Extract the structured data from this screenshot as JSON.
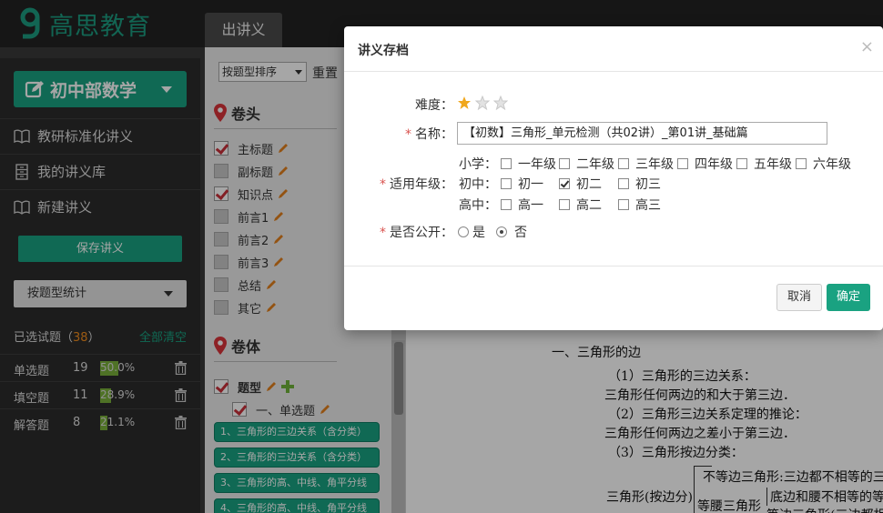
{
  "app": {
    "logo_text": "高思教育",
    "main_tab": "出讲义"
  },
  "sidebar": {
    "subject": "初中部数学",
    "nav": [
      {
        "label": "教研标准化讲义",
        "icon": "book-icon"
      },
      {
        "label": "我的讲义库",
        "icon": "cabinet-icon"
      },
      {
        "label": "新建讲义",
        "icon": "book-icon"
      }
    ],
    "save_label": "保存讲义",
    "stat_select": "按题型统计",
    "selected_label": "已选试题（",
    "selected_count": "38",
    "selected_close": "）",
    "clear_all": "全部清空",
    "stats": [
      {
        "name": "单选题",
        "count": "19",
        "percent": "50.0%",
        "fraction": 0.5
      },
      {
        "name": "填空题",
        "count": "11",
        "percent": "28.9%",
        "fraction": 0.289
      },
      {
        "name": "解答题",
        "count": "8",
        "percent": "21.1%",
        "fraction": 0.211
      }
    ]
  },
  "options": {
    "sort_select": "按题型排序",
    "reset_label": "重置",
    "head_title": "卷头",
    "head_items": [
      {
        "label": "主标题",
        "checked": true
      },
      {
        "label": "副标题",
        "checked": false
      },
      {
        "label": "知识点",
        "checked": true
      },
      {
        "label": "前言1",
        "checked": false
      },
      {
        "label": "前言2",
        "checked": false
      },
      {
        "label": "前言3",
        "checked": false
      },
      {
        "label": "总结",
        "checked": false
      },
      {
        "label": "其它",
        "checked": false
      }
    ],
    "body_title": "卷体",
    "question_type_label": "题型",
    "section_one": "一、单选题",
    "topics": [
      "1、三角形的三边关系（含分类）",
      "2、三角形的三边关系（含分类）",
      "3、三角形的高、中线、角平分线",
      "4、三角形的高、中线、角平分线"
    ]
  },
  "document": {
    "lines": [
      "一、三角形的边",
      "（1）三角形的三边关系：",
      "三角形任何两边的和大于第三边．",
      "（2）三角形三边关系定理的推论：",
      "三角形任何两边之差小于第三边．",
      "（3）三角形按边分类：",
      "不等边三角形:三边都不相等的三角",
      "三角形(按边分)",
      "等腰三角形",
      "底边和腰不相等的等腰",
      "等边三角形(三边都相"
    ]
  },
  "modal": {
    "title": "讲义存档",
    "close": "×",
    "difficulty_label": "难度：",
    "difficulty_stars": 1,
    "difficulty_max": 3,
    "name_label": "名称：",
    "name_value": "【初数】三角形_单元检测（共02讲）_第01讲_基础篇",
    "grade_label": "适用年级：",
    "grade_groups": [
      {
        "label": "小学：",
        "grades": [
          {
            "name": "一年级",
            "checked": false
          },
          {
            "name": "二年级",
            "checked": false
          },
          {
            "name": "三年级",
            "checked": false
          },
          {
            "name": "四年级",
            "checked": false
          },
          {
            "name": "五年级",
            "checked": false
          },
          {
            "name": "六年级",
            "checked": false
          }
        ]
      },
      {
        "label": "初中：",
        "grades": [
          {
            "name": "初一",
            "checked": false
          },
          {
            "name": "初二",
            "checked": true
          },
          {
            "name": "初三",
            "checked": false
          }
        ]
      },
      {
        "label": "高中：",
        "grades": [
          {
            "name": "高一",
            "checked": false
          },
          {
            "name": "高二",
            "checked": false
          },
          {
            "name": "高三",
            "checked": false
          }
        ]
      }
    ],
    "public_label": "是否公开：",
    "public_options": [
      {
        "name": "是",
        "selected": false
      },
      {
        "name": "否",
        "selected": true
      }
    ],
    "required_mark": "*",
    "cancel_label": "取消",
    "ok_label": "确定"
  },
  "colors": {
    "accent": "#1aa281",
    "star": "#f0a81e",
    "count": "#f08c1e",
    "check": "#c9303a"
  }
}
